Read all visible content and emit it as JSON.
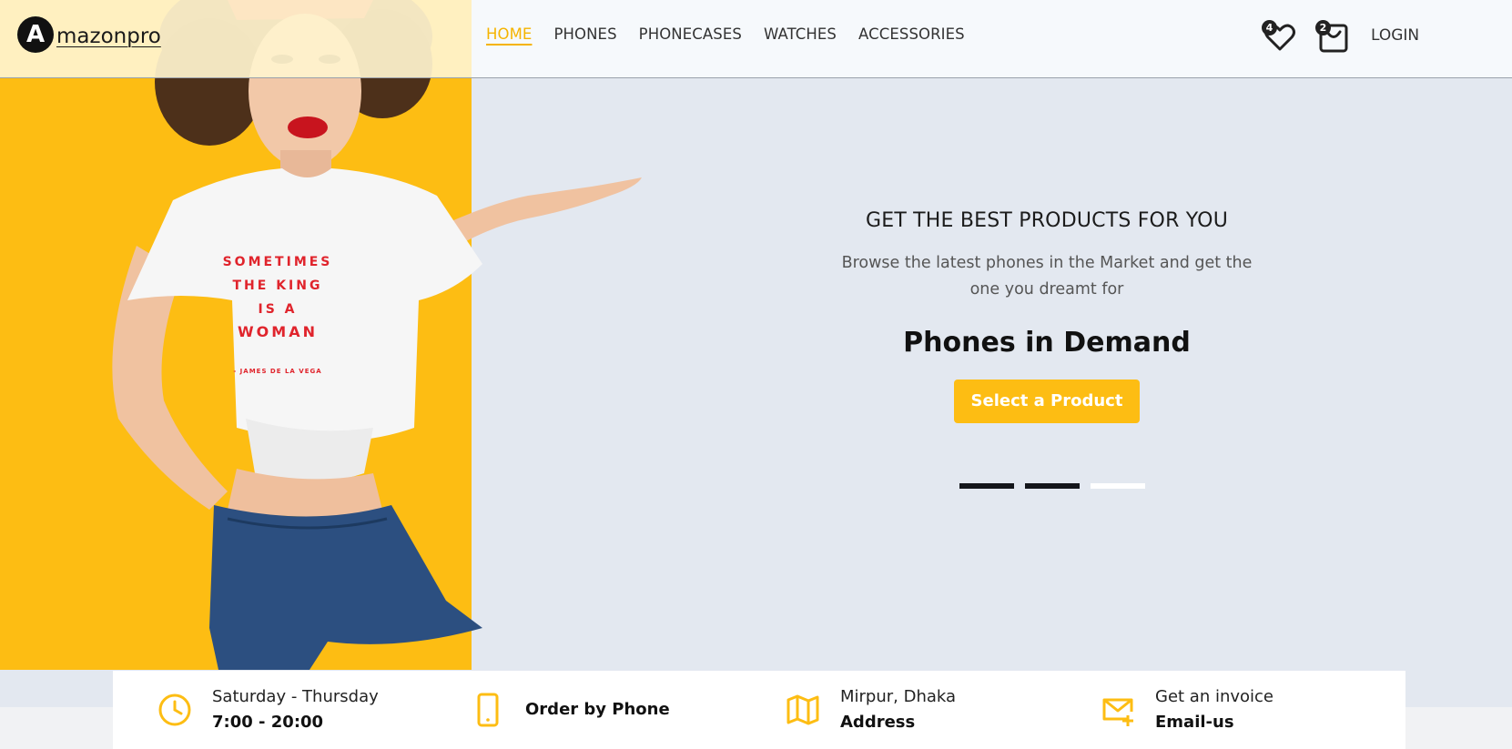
{
  "brand": {
    "logo_letter": "A",
    "name": "mazonpro"
  },
  "nav": {
    "items": [
      {
        "label": "HOME",
        "active": true
      },
      {
        "label": "PHONES",
        "active": false
      },
      {
        "label": "PHONECASES",
        "active": false
      },
      {
        "label": "WATCHES",
        "active": false
      },
      {
        "label": "ACCESSORIES",
        "active": false
      }
    ]
  },
  "header": {
    "wishlist": {
      "icon": "heart-icon",
      "count": "4"
    },
    "cart": {
      "icon": "bag-icon",
      "count": "2"
    },
    "login_label": "LOGIN"
  },
  "hero": {
    "eyebrow": "GET THE BEST PRODUCTS FOR YOU",
    "description": "Browse the latest phones in the Market and get the one you dreamt for",
    "title": "Phones in Demand",
    "cta_label": "Select a Product",
    "tshirt_text": [
      "SOMETIMES",
      "THE KING",
      "IS A",
      "WOMAN"
    ],
    "tshirt_caption": "- JAMES DE LA VEGA",
    "slides": [
      {
        "active": true
      },
      {
        "active": true
      },
      {
        "active": false
      }
    ]
  },
  "info": [
    {
      "icon": "clock-icon",
      "line1": "Saturday - Thursday",
      "line2": "7:00 - 20:00"
    },
    {
      "icon": "phone-icon",
      "line1": "",
      "line2": "Order by Phone"
    },
    {
      "icon": "map-icon",
      "line1": "Mirpur, Dhaka",
      "line2": "Address"
    },
    {
      "icon": "mail-plus-icon",
      "line1": "Get an invoice",
      "line2": "Email-us"
    }
  ],
  "colors": {
    "accent": "#fdbd13",
    "hero_bg": "#e3e8f0",
    "dark": "#14161b"
  }
}
